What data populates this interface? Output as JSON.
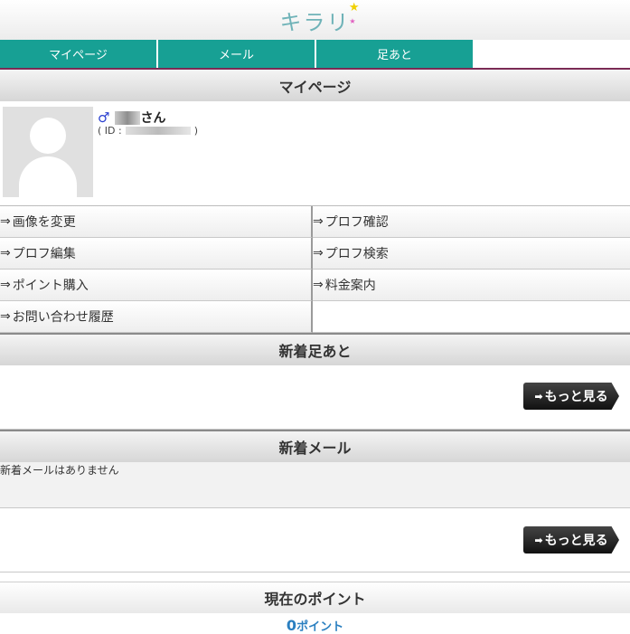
{
  "header": {
    "logo": "キラリ"
  },
  "nav": {
    "items": [
      "マイページ",
      "メール",
      "足あと"
    ]
  },
  "mypage": {
    "title": "マイページ",
    "name_suffix": "さん",
    "id_prefix": "( ID :",
    "id_suffix": ")"
  },
  "menu": {
    "arrow": "⇒",
    "items": [
      "画像を変更",
      "プロフ確認",
      "プロフ編集",
      "プロフ検索",
      "ポイント購入",
      "料金案内",
      "お問い合わせ履歴"
    ]
  },
  "footprints": {
    "title": "新着足あと",
    "more": "もっと見る"
  },
  "mail": {
    "title": "新着メール",
    "empty": "新着メールはありません",
    "more": "もっと見る"
  },
  "points": {
    "title": "現在のポイント",
    "value": "0",
    "unit": "ポイント"
  }
}
